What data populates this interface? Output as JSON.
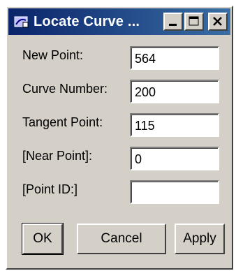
{
  "window": {
    "title": "Locate Curve ..."
  },
  "form": {
    "fields": [
      {
        "label": "New Point:",
        "value": "564"
      },
      {
        "label": "Curve Number:",
        "value": "200"
      },
      {
        "label": "Tangent Point:",
        "value": "115"
      },
      {
        "label": "[Near Point]:",
        "value": "0"
      },
      {
        "label": "[Point ID:]",
        "value": ""
      }
    ]
  },
  "buttons": {
    "ok": "OK",
    "cancel": "Cancel",
    "apply": "Apply"
  },
  "colors": {
    "titlebar_start": "#0a246a",
    "titlebar_end": "#3a6ea5",
    "face": "#d4d0c8"
  },
  "icons": {
    "app": "map-curve-icon",
    "minimize": "minimize-icon",
    "maximize": "maximize-icon",
    "close": "close-icon"
  }
}
